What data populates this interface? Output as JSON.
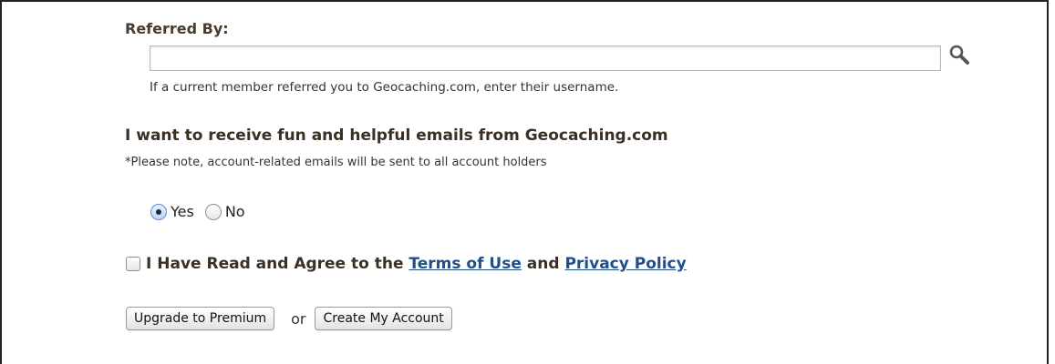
{
  "referral": {
    "label": "Referred By:",
    "input_value": "",
    "input_placeholder": "",
    "hint": "If a current member referred you to Geocaching.com, enter their username.",
    "search_icon": "magnifier-icon"
  },
  "emails": {
    "heading": "I want to receive fun and helpful emails from Geocaching.com",
    "note": "*Please note, account-related emails will be sent to all account holders",
    "options": [
      {
        "label": "Yes",
        "selected": true
      },
      {
        "label": "No",
        "selected": false
      }
    ]
  },
  "agreement": {
    "checked": false,
    "prefix": "I Have Read and Agree to the",
    "terms_link": "Terms of Use",
    "connector": "and",
    "privacy_link": "Privacy Policy"
  },
  "actions": {
    "upgrade_label": "Upgrade to Premium",
    "or_text": "or",
    "create_label": "Create My Account"
  },
  "colors": {
    "heading": "#3a2f24",
    "link": "#1f4f8a",
    "radio_selected": "#5a8fd0"
  }
}
